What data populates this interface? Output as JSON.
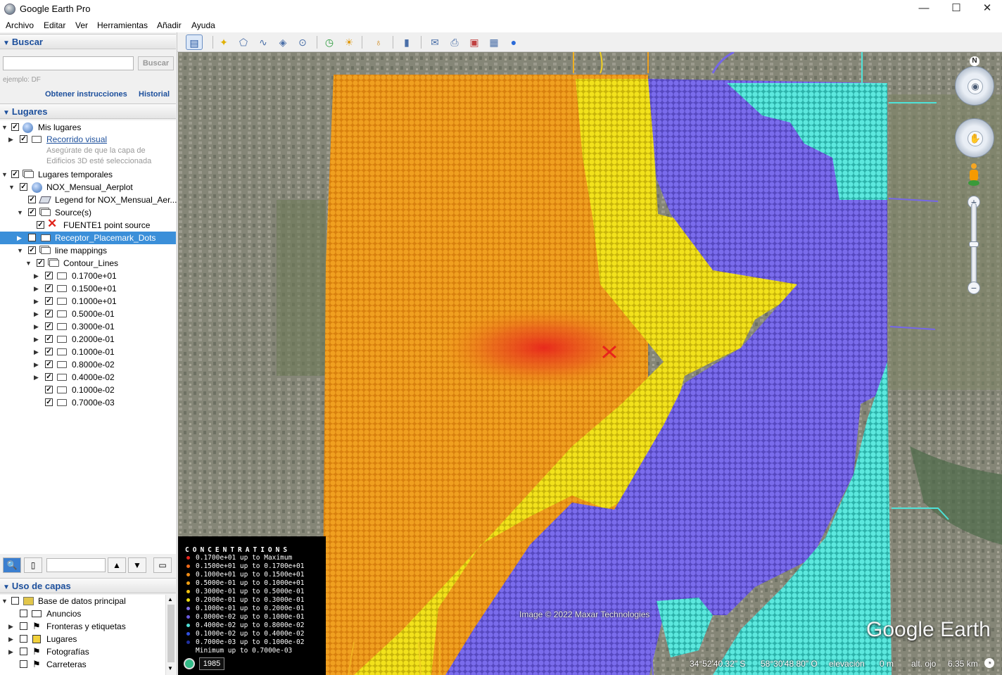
{
  "window": {
    "title": "Google Earth Pro",
    "minimize": "—",
    "maximize": "☐",
    "close": "✕"
  },
  "menu": [
    "Archivo",
    "Editar",
    "Ver",
    "Herramientas",
    "Añadir",
    "Ayuda"
  ],
  "search": {
    "header": "Buscar",
    "button": "Buscar",
    "hint": "ejemplo: DF",
    "directions": "Obtener instrucciones",
    "history": "Historial"
  },
  "places": {
    "header": "Lugares",
    "my_places": "Mis lugares",
    "tour": "Recorrido visual",
    "tour_note_1": "Asegúrate de que la capa de",
    "tour_note_2": "Edificios 3D esté seleccionada",
    "temp_places": "Lugares temporales",
    "kml": "NOX_Mensual_Aerplot",
    "legend_item": "Legend for NOX_Mensual_Aer...",
    "sources": "Source(s)",
    "source1": "FUENTE1 point source",
    "receptor": "Receptor_Placemark_Dots",
    "line_mappings": "line mappings",
    "contour_lines": "Contour_Lines",
    "contours": [
      "0.1700e+01",
      "0.1500e+01",
      "0.1000e+01",
      "0.5000e-01",
      "0.3000e-01",
      "0.2000e-01",
      "0.1000e-01",
      "0.8000e-02",
      "0.4000e-02",
      "0.1000e-02",
      "0.7000e-03"
    ]
  },
  "layers": {
    "header": "Uso de capas",
    "items": [
      "Base de datos principal",
      "Anuncios",
      "Fronteras y etiquetas",
      "Lugares",
      "Fotografías",
      "Carreteras"
    ]
  },
  "legend": {
    "title": "CONCENTRATIONS",
    "rows": [
      {
        "text": "0.1700e+01 up to Maximum",
        "color": "#e8241c"
      },
      {
        "text": "0.1500e+01 up to 0.1700e+01",
        "color": "#f06a1a"
      },
      {
        "text": "0.1000e+01 up to 0.1500e+01",
        "color": "#f08c16"
      },
      {
        "text": "0.5000e-01 up to 0.1000e+01",
        "color": "#f2a012"
      },
      {
        "text": "0.3000e-01 up to 0.5000e-01",
        "color": "#f0c010"
      },
      {
        "text": "0.2000e-01 up to 0.3000e-01",
        "color": "#f0e010"
      },
      {
        "text": "0.1000e-01 up to 0.2000e-01",
        "color": "#8070e8"
      },
      {
        "text": "0.8000e-02 up to 0.1000e-01",
        "color": "#6a5ae0"
      },
      {
        "text": "0.4000e-02 up to 0.8000e-02",
        "color": "#50e0d8"
      },
      {
        "text": "0.1000e-02 up to 0.4000e-02",
        "color": "#3050e0"
      },
      {
        "text": "0.7000e-03 up to 0.1000e-02",
        "color": "#2030a0"
      },
      {
        "text": "Minimum up to 0.7000e-03",
        "color": "#000000"
      }
    ]
  },
  "map": {
    "year": "1985",
    "imagery_credit": "Image © 2022 Maxar Technologies",
    "logo": "Google Earth",
    "lat": "34°52'40.32\" S",
    "lon": "58°30'48.80\" O",
    "elev_label": "elevación",
    "elev_value": "0 m",
    "eye_label": "alt. ojo",
    "eye_value": "6.35 km",
    "north": "N"
  },
  "colors": {
    "orange": "#ee9a1a",
    "yellow": "#e8d81a",
    "purple": "#7466e8",
    "cyan": "#4ee2d8",
    "red": "#e23a1e",
    "accent": "#1c4f9c"
  }
}
